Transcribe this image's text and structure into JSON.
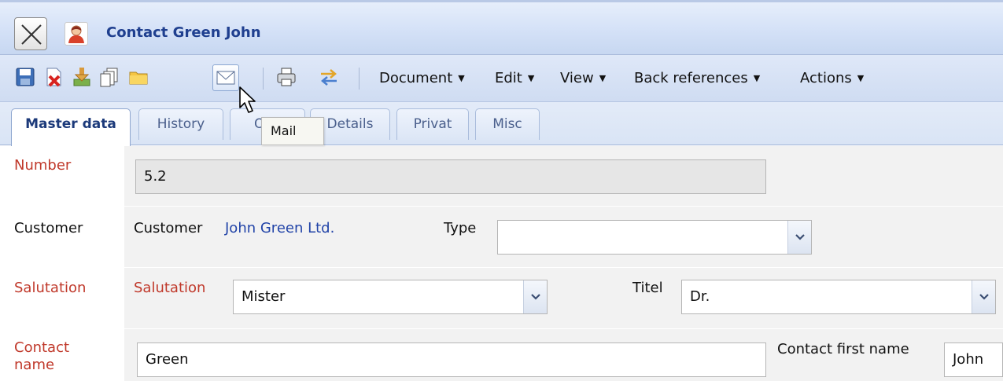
{
  "window": {
    "title": "Contact Green John"
  },
  "toolbar": {
    "icons": [
      "save-icon",
      "delete-icon",
      "download-icon",
      "copy-icon",
      "folder-icon",
      "mail-icon",
      "print-icon",
      "transfer-icon"
    ],
    "menus": {
      "document": "Document",
      "edit": "Edit",
      "view": "View",
      "back_references": "Back references",
      "actions": "Actions"
    },
    "caret": "▼"
  },
  "tooltip": {
    "text": "Mail"
  },
  "tabs": {
    "master_data": "Master data",
    "history": "History",
    "other": "Of",
    "details": "Details",
    "privat": "Privat",
    "misc": "Misc",
    "active": "Master data"
  },
  "form": {
    "number": {
      "label": "Number",
      "value": "5.2"
    },
    "customer": {
      "label": "Customer",
      "inline_label": "Customer",
      "link": "John Green Ltd.",
      "type_label": "Type",
      "type_value": ""
    },
    "salutation": {
      "label": "Salutation",
      "inline_label": "Salutation",
      "value": "Mister",
      "titel_label": "Titel",
      "titel_value": "Dr."
    },
    "contact_name": {
      "label_line1": "Contact",
      "label_line2": "name",
      "value": "Green",
      "first_name_label": "Contact first name",
      "first_name_value": "John"
    }
  },
  "colors": {
    "title_text": "#1f3f8f",
    "required_label": "#c0392b",
    "link": "#2244a8",
    "value_bg": "#f2f2f2"
  }
}
